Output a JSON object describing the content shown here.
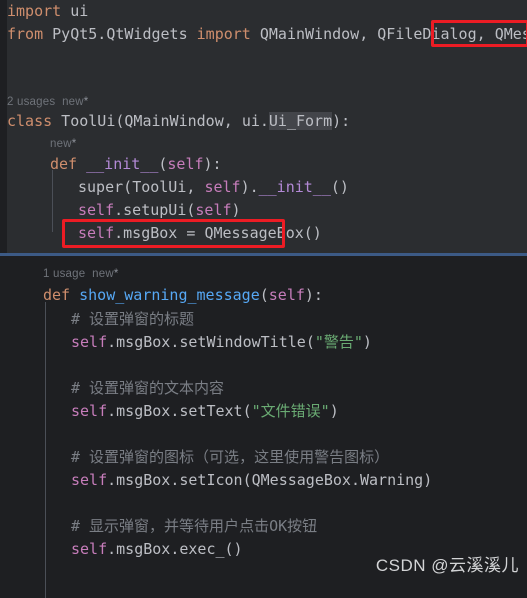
{
  "editor": {
    "theme_bg_top": "#2b2d30",
    "theme_bg_bottom": "#1e1f22",
    "splitter_color": "#3c5a86",
    "annotation_color": "#ec1c24"
  },
  "top_pane": {
    "line1": {
      "kw": "import",
      "rest": " ui"
    },
    "line2": {
      "kw": "from",
      "module": " PyQt5.QtWidgets ",
      "kw2": "import",
      "names": " QMainWindow, QFileDialog, ",
      "highlighted_name": "QMessageBox"
    },
    "usages_hint": {
      "usages": "2 usages",
      "new": "new",
      "star": "*"
    },
    "class_line": {
      "kw": "class",
      "name": " ToolUi",
      "open": "(",
      "base1": "QMainWindow",
      "comma": ", ",
      "mod": "ui.",
      "base2": "Ui_Form",
      "close": "):"
    },
    "new_hint": {
      "new": "new",
      "star": "*"
    },
    "init_line": {
      "kw": "def",
      "name": "__init__",
      "open": "(",
      "arg": "self",
      "close": "):"
    },
    "super_line": {
      "call": "super",
      "open": "(",
      "arg1": "ToolUi",
      "comma": ", ",
      "arg2": "self",
      "close": ")",
      "dot": ".",
      "dunder": "__init__",
      "parens": "()"
    },
    "setup_line": {
      "self": "self",
      "dot": ".",
      "call": "setupUi",
      "open": "(",
      "arg": "self",
      "close": ")"
    },
    "msgbox_line": {
      "self": "self",
      "dot": ".",
      "attr": "msgBox",
      "eq": " = ",
      "ctor": "QMessageBox()"
    }
  },
  "bottom_pane": {
    "usages_hint": {
      "usages": "1 usage",
      "new": "new",
      "star": "*"
    },
    "def_line": {
      "kw": "def",
      "name": "show_warning_message",
      "open": "(",
      "arg": "self",
      "close": "):"
    },
    "comment1": "# 设置弹窗的标题",
    "stmt1": {
      "self": "self",
      "dot1": ".",
      "attr": "msgBox",
      "dot2": ".",
      "call": "setWindowTitle",
      "open": "(",
      "str": "\"警告\"",
      "close": ")"
    },
    "comment2": "# 设置弹窗的文本内容",
    "stmt2": {
      "self": "self",
      "dot1": ".",
      "attr": "msgBox",
      "dot2": ".",
      "call": "setText",
      "open": "(",
      "str": "\"文件错误\"",
      "close": ")"
    },
    "comment3": "# 设置弹窗的图标（可选，这里使用警告图标）",
    "stmt3": {
      "self": "self",
      "dot1": ".",
      "attr": "msgBox",
      "dot2": ".",
      "call": "setIcon",
      "open": "(",
      "arg": "QMessageBox.Warning",
      "close": ")"
    },
    "comment4": "# 显示弹窗，并等待用户点击OK按钮",
    "stmt4": {
      "self": "self",
      "dot1": ".",
      "attr": "msgBox",
      "dot2": ".",
      "call": "exec_",
      "parens": "()"
    }
  },
  "watermark": "CSDN @云溪溪儿"
}
